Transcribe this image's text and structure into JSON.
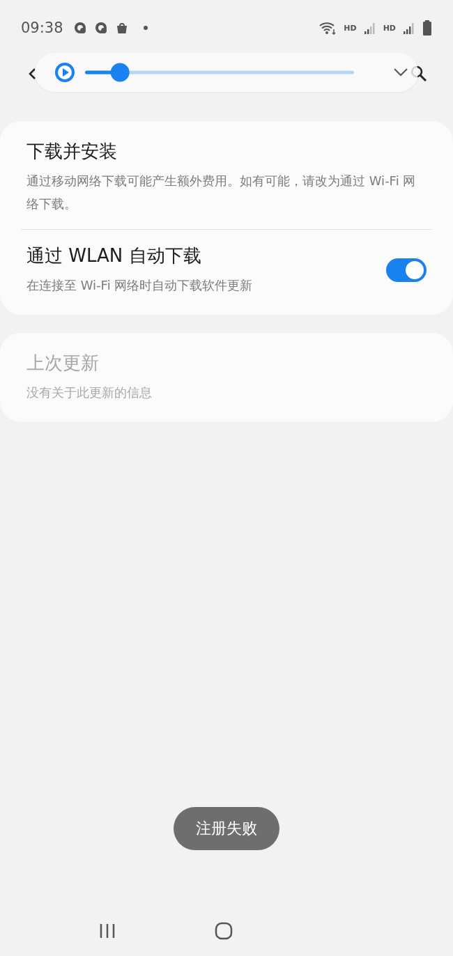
{
  "status_bar": {
    "time": "09:38",
    "network_labels": [
      "HD",
      "HD"
    ]
  },
  "media_player": {
    "level": 0.13
  },
  "settings_cards": [
    {
      "items": [
        {
          "kind": "plain",
          "title": "下载并安装",
          "summary": "通过移动网络下载可能产生额外费用。如有可能，请改为通过 Wi-Fi 网络下载。",
          "disabled": false
        },
        {
          "kind": "switch",
          "title": "通过 WLAN 自动下载",
          "summary": "在连接至 Wi-Fi 网络时自动下载软件更新",
          "on": true,
          "disabled": false
        }
      ]
    },
    {
      "items": [
        {
          "kind": "plain",
          "title": "上次更新",
          "summary": "没有关于此更新的信息",
          "disabled": true
        }
      ]
    }
  ],
  "toast": "注册失败"
}
